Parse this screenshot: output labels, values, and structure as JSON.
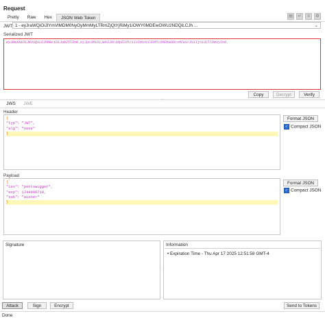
{
  "panel_title": "Request",
  "tabs": [
    "Pretty",
    "Raw",
    "Hex",
    "JSON Web Token"
  ],
  "active_tab": "JSON Web Token",
  "jwt": {
    "label": "JWT",
    "selected": "1 - eyJraWQiOiJlYmVlMDM0NyOyMmMyLTRmZjQtYjRiMy1iOWY0MDEwOWU2NDQiLCJh ..."
  },
  "serialized": {
    "label": "Serialized JWT",
    "part1": "eyJ0eXAiOiJKV1QiLCJhbGciOiJub25lIn0.",
    "part2": "eyJpc3MiOiJwb3J0c3dpZ2dlciIsImV4cCI6MTc0NDkwODcxMCwic3ViIjoid2llbmVyIn0."
  },
  "serialized_buttons": {
    "copy": "Copy",
    "decrypt": "Decrypt",
    "verify": "Verify"
  },
  "subtabs": [
    "JWS",
    "JWE"
  ],
  "header": {
    "label": "Header",
    "lines": [
      "{",
      "    \"typ\": \"JWT\",",
      "    \"alg\": \"none\"",
      "}"
    ],
    "format_button": "Format JSON",
    "compact_label": "Compact JSON"
  },
  "payload": {
    "label": "Payload",
    "lines": [
      "{",
      "    \"iss\": \"portswigger\",",
      "    \"exp\": 1744908710,",
      "    \"sub\": \"wiener\"",
      "}"
    ],
    "format_button": "Format JSON",
    "compact_label": "Compact JSON"
  },
  "signature": {
    "label": "Signature"
  },
  "information": {
    "label": "Information",
    "items": [
      "Expiration Time - Thu Apr 17 2025 12:51:58 GMT-4"
    ]
  },
  "footer_buttons": {
    "attack": "Attack",
    "sign": "Sign",
    "encrypt": "Encrypt",
    "send": "Send to Tokens"
  },
  "status": "Done",
  "colors": {
    "accent": "#2b6dd6",
    "error_border": "#dd3333",
    "highlight": "#fff8b8",
    "token": "#cc2fcc"
  }
}
